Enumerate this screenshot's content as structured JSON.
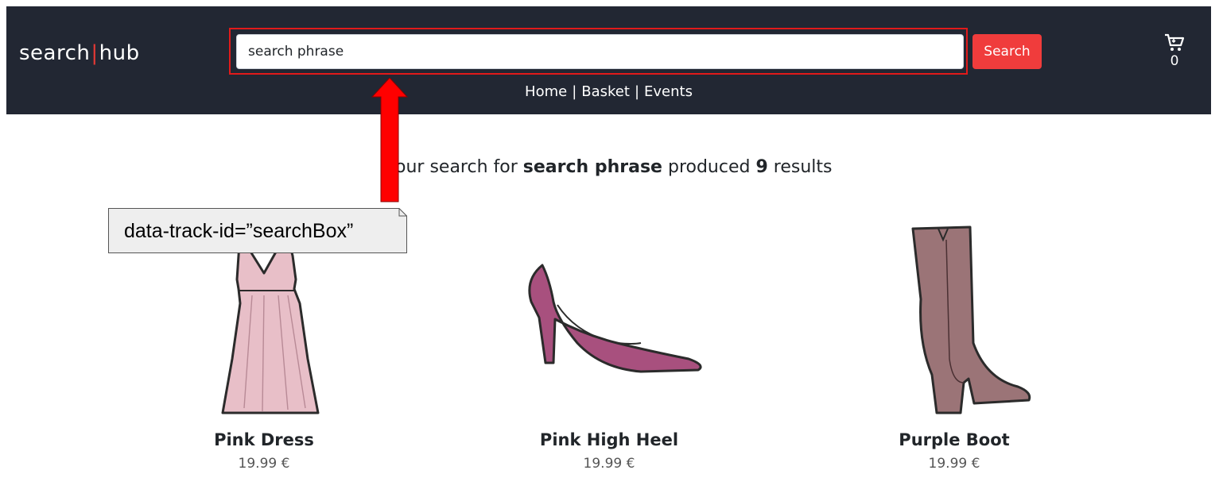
{
  "header": {
    "logo_left": "search",
    "logo_sep": "|",
    "logo_right": "hub",
    "search": {
      "value": "search phrase",
      "placeholder": ""
    },
    "search_button": "Search",
    "cart_count": "0",
    "nav": {
      "home": "Home",
      "sep": "|",
      "basket": "Basket",
      "events": "Events"
    }
  },
  "results": {
    "prefix": "Your search for",
    "query": "search phrase",
    "middle": "produced",
    "count": "9",
    "suffix": "results"
  },
  "products": [
    {
      "name": "Pink Dress",
      "price": "19.99 €",
      "icon": "dress-image",
      "color": "#e8bfc8"
    },
    {
      "name": "Pink High Heel",
      "price": "19.99 €",
      "icon": "high-heel-image",
      "color": "#a8507e"
    },
    {
      "name": "Purple Boot",
      "price": "19.99 €",
      "icon": "boot-image",
      "color": "#9b7477"
    }
  ],
  "annotation": {
    "label": "data-track-id=”searchBox”",
    "arrow_color": "#ff0000",
    "box_color": "#e11a1a"
  }
}
